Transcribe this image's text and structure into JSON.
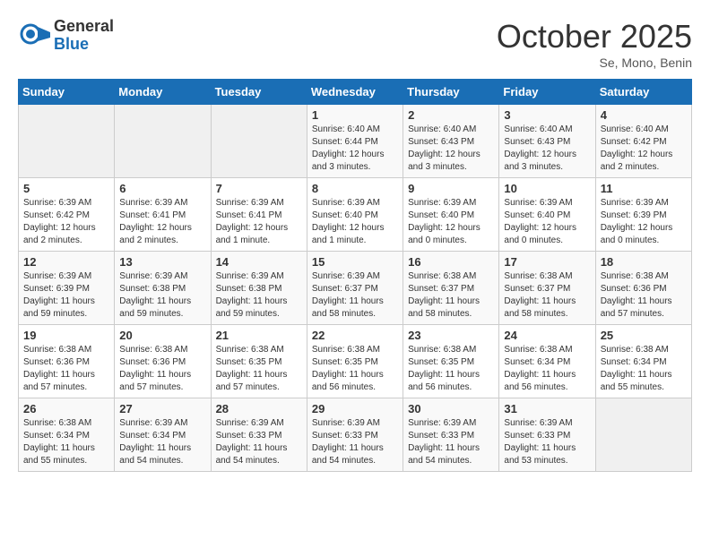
{
  "header": {
    "logo_general": "General",
    "logo_blue": "Blue",
    "month_title": "October 2025",
    "location": "Se, Mono, Benin"
  },
  "days_of_week": [
    "Sunday",
    "Monday",
    "Tuesday",
    "Wednesday",
    "Thursday",
    "Friday",
    "Saturday"
  ],
  "weeks": [
    [
      {
        "day": "",
        "info": ""
      },
      {
        "day": "",
        "info": ""
      },
      {
        "day": "",
        "info": ""
      },
      {
        "day": "1",
        "info": "Sunrise: 6:40 AM\nSunset: 6:44 PM\nDaylight: 12 hours\nand 3 minutes."
      },
      {
        "day": "2",
        "info": "Sunrise: 6:40 AM\nSunset: 6:43 PM\nDaylight: 12 hours\nand 3 minutes."
      },
      {
        "day": "3",
        "info": "Sunrise: 6:40 AM\nSunset: 6:43 PM\nDaylight: 12 hours\nand 3 minutes."
      },
      {
        "day": "4",
        "info": "Sunrise: 6:40 AM\nSunset: 6:42 PM\nDaylight: 12 hours\nand 2 minutes."
      }
    ],
    [
      {
        "day": "5",
        "info": "Sunrise: 6:39 AM\nSunset: 6:42 PM\nDaylight: 12 hours\nand 2 minutes."
      },
      {
        "day": "6",
        "info": "Sunrise: 6:39 AM\nSunset: 6:41 PM\nDaylight: 12 hours\nand 2 minutes."
      },
      {
        "day": "7",
        "info": "Sunrise: 6:39 AM\nSunset: 6:41 PM\nDaylight: 12 hours\nand 1 minute."
      },
      {
        "day": "8",
        "info": "Sunrise: 6:39 AM\nSunset: 6:40 PM\nDaylight: 12 hours\nand 1 minute."
      },
      {
        "day": "9",
        "info": "Sunrise: 6:39 AM\nSunset: 6:40 PM\nDaylight: 12 hours\nand 0 minutes."
      },
      {
        "day": "10",
        "info": "Sunrise: 6:39 AM\nSunset: 6:40 PM\nDaylight: 12 hours\nand 0 minutes."
      },
      {
        "day": "11",
        "info": "Sunrise: 6:39 AM\nSunset: 6:39 PM\nDaylight: 12 hours\nand 0 minutes."
      }
    ],
    [
      {
        "day": "12",
        "info": "Sunrise: 6:39 AM\nSunset: 6:39 PM\nDaylight: 11 hours\nand 59 minutes."
      },
      {
        "day": "13",
        "info": "Sunrise: 6:39 AM\nSunset: 6:38 PM\nDaylight: 11 hours\nand 59 minutes."
      },
      {
        "day": "14",
        "info": "Sunrise: 6:39 AM\nSunset: 6:38 PM\nDaylight: 11 hours\nand 59 minutes."
      },
      {
        "day": "15",
        "info": "Sunrise: 6:39 AM\nSunset: 6:37 PM\nDaylight: 11 hours\nand 58 minutes."
      },
      {
        "day": "16",
        "info": "Sunrise: 6:38 AM\nSunset: 6:37 PM\nDaylight: 11 hours\nand 58 minutes."
      },
      {
        "day": "17",
        "info": "Sunrise: 6:38 AM\nSunset: 6:37 PM\nDaylight: 11 hours\nand 58 minutes."
      },
      {
        "day": "18",
        "info": "Sunrise: 6:38 AM\nSunset: 6:36 PM\nDaylight: 11 hours\nand 57 minutes."
      }
    ],
    [
      {
        "day": "19",
        "info": "Sunrise: 6:38 AM\nSunset: 6:36 PM\nDaylight: 11 hours\nand 57 minutes."
      },
      {
        "day": "20",
        "info": "Sunrise: 6:38 AM\nSunset: 6:36 PM\nDaylight: 11 hours\nand 57 minutes."
      },
      {
        "day": "21",
        "info": "Sunrise: 6:38 AM\nSunset: 6:35 PM\nDaylight: 11 hours\nand 57 minutes."
      },
      {
        "day": "22",
        "info": "Sunrise: 6:38 AM\nSunset: 6:35 PM\nDaylight: 11 hours\nand 56 minutes."
      },
      {
        "day": "23",
        "info": "Sunrise: 6:38 AM\nSunset: 6:35 PM\nDaylight: 11 hours\nand 56 minutes."
      },
      {
        "day": "24",
        "info": "Sunrise: 6:38 AM\nSunset: 6:34 PM\nDaylight: 11 hours\nand 56 minutes."
      },
      {
        "day": "25",
        "info": "Sunrise: 6:38 AM\nSunset: 6:34 PM\nDaylight: 11 hours\nand 55 minutes."
      }
    ],
    [
      {
        "day": "26",
        "info": "Sunrise: 6:38 AM\nSunset: 6:34 PM\nDaylight: 11 hours\nand 55 minutes."
      },
      {
        "day": "27",
        "info": "Sunrise: 6:39 AM\nSunset: 6:34 PM\nDaylight: 11 hours\nand 54 minutes."
      },
      {
        "day": "28",
        "info": "Sunrise: 6:39 AM\nSunset: 6:33 PM\nDaylight: 11 hours\nand 54 minutes."
      },
      {
        "day": "29",
        "info": "Sunrise: 6:39 AM\nSunset: 6:33 PM\nDaylight: 11 hours\nand 54 minutes."
      },
      {
        "day": "30",
        "info": "Sunrise: 6:39 AM\nSunset: 6:33 PM\nDaylight: 11 hours\nand 54 minutes."
      },
      {
        "day": "31",
        "info": "Sunrise: 6:39 AM\nSunset: 6:33 PM\nDaylight: 11 hours\nand 53 minutes."
      },
      {
        "day": "",
        "info": ""
      }
    ]
  ]
}
